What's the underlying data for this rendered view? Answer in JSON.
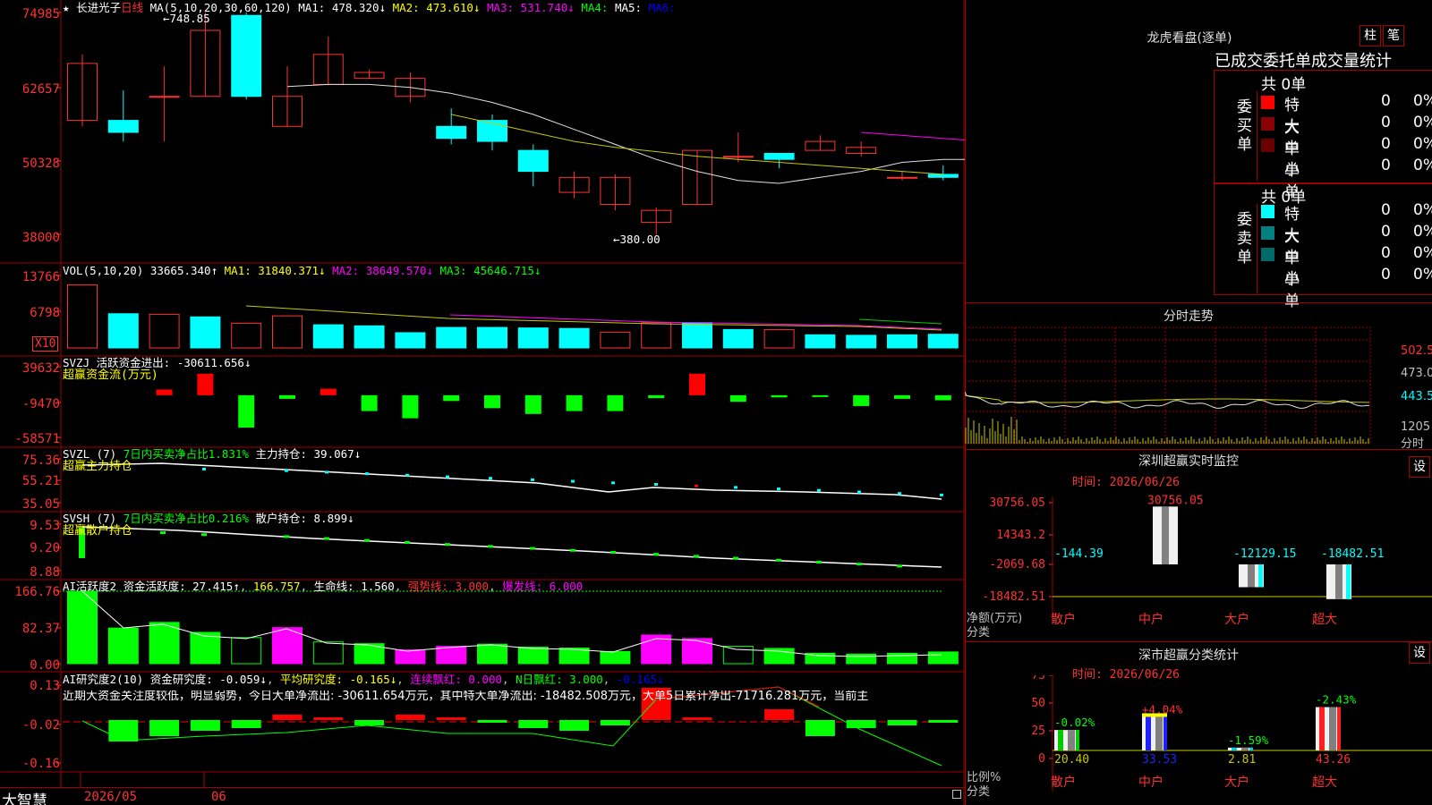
{
  "colors": {
    "up": "#ff3232",
    "down": "#00ffff",
    "buy_red": "#ff0000",
    "sell_green": "#00ff00",
    "grid": "#a00000",
    "ma_white": "#e0e0e0",
    "ma_yellow": "#c8c800",
    "ma_magenta": "#ff00ff",
    "blue": "#2020ff"
  },
  "main_panel": {
    "star": "★",
    "stock_name": "长进光子",
    "period": "日线",
    "high_marker": "←748.85",
    "low_marker": "←380.00",
    "ma_label": "MA(5,10,20,30,60,120)",
    "ma1": "MA1: 478.320↓",
    "ma2": "MA2: 473.610↓",
    "ma3": "MA3: 531.740↓",
    "ma4": "MA4:",
    "ma5": "MA5:",
    "ma6": "MA6:",
    "y_labels": [
      "74985",
      "62657",
      "50328",
      "38000"
    ]
  },
  "vol_panel": {
    "label": "VOL(5,10,20)",
    "vol": "33665.340↑",
    "ma1": "MA1: 31840.371↓",
    "ma2": "MA2: 38649.570↓",
    "ma3": "MA3: 45646.715↓",
    "y_labels": [
      "13766",
      "6798"
    ],
    "x10": "X10"
  },
  "svzj_panel": {
    "label": "SVZJ",
    "title": "活跃资金进出: -30611.656↓",
    "subtitle": "超赢资金流(万元)",
    "y_labels": [
      "39632",
      "-9470",
      "-58571"
    ]
  },
  "svzl_panel": {
    "label": "SVZL (7)",
    "ratio": "7日内买卖净占比1.831%",
    "hold": "主力持仓: 39.067↓",
    "subtitle": "超赢主力持仓",
    "y_labels": [
      "75.36",
      "55.21",
      "35.05"
    ]
  },
  "svsh_panel": {
    "label": "SVSH (7)",
    "ratio": "7日内买卖净占比0.216%",
    "hold": "散户持仓: 8.899↓",
    "subtitle": "超赢散户持仓",
    "y_labels": [
      "9.53",
      "9.20",
      "8.88"
    ]
  },
  "ai_active_panel": {
    "label": "AI活跃度2",
    "active": "资金活跃度: 27.415↑",
    "v2": "166.757",
    "life": "生命线: 1.560",
    "strong": "强势线: 3.000",
    "burst": "爆发线: 6.000",
    "y_labels": [
      "166.76",
      "82.37",
      "0.00"
    ]
  },
  "ai_research_panel": {
    "label": "AI研究度2(10)",
    "research": "资金研究度: -0.059↓",
    "avg": "平均研究度: -0.165↓",
    "red_streak": "连续飘红: 0.000",
    "n_red": "N日飘红: 3.000",
    "last": "-0.165↓",
    "comment": "近期大资金关注度较低，明显弱势，今日大单净流出: -30611.654万元，其中特大单净流出: -18482.508万元，大单5日累计净出-71716.281万元，当前主",
    "y_labels": [
      "0.13",
      "-0.02",
      "-0.16"
    ]
  },
  "bottom_bar": {
    "brand": "大智慧",
    "date1": "2026/05",
    "date2": "06"
  },
  "longhu": {
    "title": "龙虎看盘(逐单)",
    "btn1": "柱",
    "btn2": "笔",
    "tabs": "已成交委托单成交量统计",
    "buy_total": "共 0单",
    "buy_label": [
      "委",
      "买",
      "单"
    ],
    "sell_total": "共 0单",
    "sell_label": [
      "委",
      "卖",
      "单"
    ],
    "rows_buy": [
      {
        "label": "特大",
        "count": "0",
        "pct": "0%",
        "color": "#ff0000"
      },
      {
        "label": "大单",
        "count": "0",
        "pct": "0%",
        "color": "#8b0000"
      },
      {
        "label": "中单",
        "count": "0",
        "pct": "0%",
        "color": "#6b0000"
      },
      {
        "label": "小单",
        "count": "0",
        "pct": "0%",
        "color": "#000000"
      }
    ],
    "rows_sell": [
      {
        "label": "特大",
        "count": "0",
        "pct": "0%",
        "color": "#00ffff"
      },
      {
        "label": "大单",
        "count": "0",
        "pct": "0%",
        "color": "#008080"
      },
      {
        "label": "中单",
        "count": "0",
        "pct": "0%",
        "color": "#006a6a"
      },
      {
        "label": "小单",
        "count": "0",
        "pct": "0%",
        "color": "#000000"
      }
    ]
  },
  "intraday": {
    "title": "分时走势",
    "y_labels": [
      "502.5",
      "473.0",
      "443.5",
      "1205"
    ],
    "x_label": "分时"
  },
  "sz_monitor": {
    "title": "深圳超赢实时监控",
    "btn": "设",
    "time": "时间: 2026/06/26",
    "y_labels": [
      "30756.05",
      "14343.2",
      "-2069.68",
      "-18482.51"
    ],
    "y_caption": "净额(万元)",
    "x_caption": "分类",
    "categories": [
      "散户",
      "中户",
      "大户",
      "超大"
    ],
    "values": [
      -144.39,
      30756.05,
      -12129.15,
      -18482.51
    ],
    "value_labels": [
      "-144.39",
      "30756.05",
      "-12129.15",
      "-18482.51"
    ]
  },
  "sz_class": {
    "title": "深市超赢分类统计",
    "btn": "设",
    "time": "时间: 2026/06/26",
    "y_labels": [
      "75",
      "50",
      "25",
      "0"
    ],
    "y_caption": "比例%",
    "x_caption": "分类",
    "categories": [
      "散户",
      "中户",
      "大户",
      "超大"
    ],
    "shares": [
      20.4,
      33.53,
      2.81,
      43.26
    ],
    "share_labels": [
      "20.40",
      "33.53",
      "2.81",
      "43.26"
    ],
    "changes": [
      "-0.02%",
      "+4.04%",
      "-1.59%",
      "-2.43%"
    ]
  },
  "chart_data": [
    {
      "type": "candlestick",
      "title": "长进光子 日线",
      "ylim": [
        38000,
        74985
      ],
      "ohlc": [
        [
          57000,
          66500,
          56000,
          68000
        ],
        [
          57000,
          55000,
          53500,
          62000
        ],
        [
          61000,
          61000,
          53500,
          66000
        ],
        [
          61000,
          72000,
          61000,
          75000
        ],
        [
          74500,
          61000,
          60500,
          74985
        ],
        [
          56000,
          61000,
          56000,
          66000
        ],
        [
          63000,
          68000,
          63000,
          71000
        ],
        [
          64000,
          65000,
          64000,
          65500
        ],
        [
          61000,
          64000,
          60000,
          65000
        ],
        [
          56000,
          54000,
          53000,
          59000
        ],
        [
          57000,
          53500,
          52000,
          58000
        ],
        [
          52000,
          48500,
          46000,
          53000
        ],
        [
          45000,
          47500,
          44000,
          48500
        ],
        [
          43000,
          47500,
          42000,
          48000
        ],
        [
          40000,
          42000,
          38000,
          42500
        ],
        [
          43000,
          52000,
          43000,
          52000
        ],
        [
          51000,
          51000,
          50000,
          55000
        ],
        [
          51500,
          50500,
          49000,
          51500
        ],
        [
          52000,
          53500,
          52000,
          54500
        ],
        [
          51500,
          52500,
          51000,
          53500
        ],
        [
          47500,
          47500,
          47000,
          48500
        ],
        [
          48000,
          47500,
          47000,
          49500
        ],
        [
          43500,
          47000,
          42500,
          47000
        ]
      ],
      "ma_white": [
        62657,
        63000,
        63000,
        62500,
        61500,
        60000,
        58000,
        55500,
        53000,
        50500,
        48500,
        47000,
        46500,
        47500,
        48500,
        50000,
        50500,
        50500,
        50000,
        49500,
        49000
      ],
      "ma_yellow": [
        58000,
        56500,
        55000,
        53500,
        52500,
        51800,
        51000,
        50500,
        50000,
        49500,
        49000,
        48500,
        48000
      ]
    },
    {
      "type": "bar",
      "title": "VOL(5,10,20)",
      "ylim": [
        0,
        13766
      ],
      "values": [
        12000,
        6500,
        6400,
        5900,
        4700,
        6100,
        4400,
        4200,
        2900,
        3900,
        3900,
        3800,
        3700,
        3000,
        4800,
        4800,
        3500,
        3500,
        2500,
        2400,
        2500,
        2600,
        3366
      ],
      "up": [
        true,
        false,
        true,
        false,
        true,
        true,
        false,
        false,
        false,
        false,
        false,
        false,
        false,
        true,
        true,
        false,
        false,
        true,
        false,
        false,
        false,
        false,
        false
      ]
    },
    {
      "type": "bar",
      "title": "活跃资金进出",
      "ylim": [
        -58571,
        39632
      ],
      "values": [
        0,
        0,
        8000,
        30000,
        -45000,
        -5000,
        9000,
        -22000,
        -32000,
        -8000,
        -18000,
        -26000,
        -22000,
        -22000,
        -4000,
        30000,
        -9000,
        -3000,
        -1000,
        -15000,
        -5000,
        -7000,
        -30612
      ]
    },
    {
      "type": "bar",
      "title": "资金活跃度",
      "ylim": [
        0,
        166.76
      ],
      "values": [
        166.76,
        82,
        95,
        72,
        60,
        83,
        50,
        46,
        32,
        40,
        45,
        38,
        36,
        28,
        66,
        58,
        40,
        35,
        24,
        22,
        24,
        27,
        27.415
      ],
      "pink": [
        false,
        false,
        false,
        false,
        false,
        true,
        false,
        false,
        true,
        true,
        false,
        false,
        false,
        false,
        true,
        true,
        false,
        false,
        false,
        false,
        false,
        false,
        false
      ]
    },
    {
      "type": "bar",
      "title": "资金研究度",
      "ylim": [
        -0.16,
        0.13
      ],
      "values": [
        0,
        -0.08,
        -0.06,
        -0.04,
        -0.03,
        0.02,
        0.01,
        -0.02,
        0.02,
        0.01,
        -0.01,
        -0.03,
        -0.04,
        -0.02,
        0.12,
        0.01,
        0.0,
        0.04,
        -0.06,
        -0.03,
        -0.02,
        -0.01,
        -0.059
      ]
    }
  ]
}
